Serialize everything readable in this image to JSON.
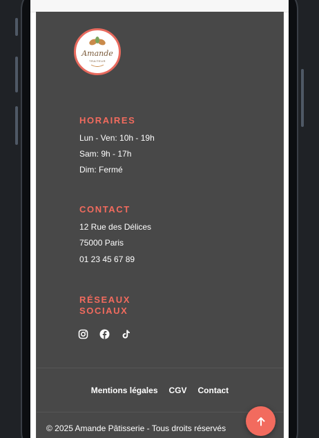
{
  "brand": {
    "logo_name": "Amande",
    "logo_subtitle": "TRAITEUR",
    "accent_color": "#f26b5e",
    "footer_bg": "#484848"
  },
  "hours": {
    "title": "HORAIRES",
    "lines": [
      "Lun - Ven: 10h - 19h",
      "Sam: 9h - 17h",
      "Dim: Fermé"
    ]
  },
  "contact": {
    "title": "CONTACT",
    "lines": [
      "12 Rue des Délices",
      "75000 Paris",
      "01 23 45 67 89"
    ]
  },
  "social": {
    "title_line1": "RÉSEAUX",
    "title_line2": "SOCIAUX",
    "icons": [
      "instagram-icon",
      "facebook-icon",
      "tiktok-icon"
    ]
  },
  "legal": {
    "links": [
      "Mentions légales",
      "CGV",
      "Contact"
    ]
  },
  "copyright": "© 2025 Amande Pâtisserie - Tous droits réservés",
  "scroll_top": {
    "icon": "arrow-up-icon"
  }
}
